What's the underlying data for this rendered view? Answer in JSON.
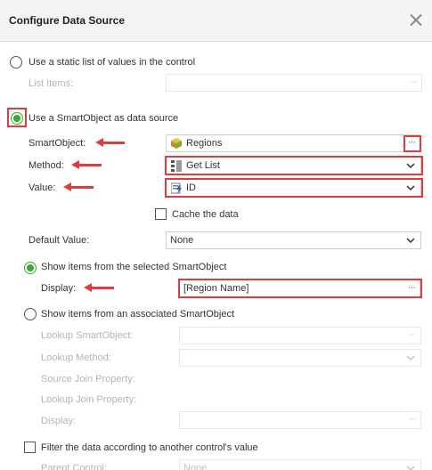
{
  "dialog": {
    "title": "Configure Data Source"
  },
  "static_list": {
    "label": "Use a static list of values in the control",
    "list_items_label": "List Items:",
    "ellipsis": "···"
  },
  "smartobject": {
    "label": "Use a SmartObject as data source",
    "smartobject_label": "SmartObject:",
    "smartobject_value": "Regions",
    "method_label": "Method:",
    "method_value": "Get List",
    "value_label": "Value:",
    "value_value": "ID",
    "cache_label": "Cache the data",
    "default_value_label": "Default Value:",
    "default_value_value": "None",
    "ellipsis": "···"
  },
  "show_selected": {
    "label": "Show items from the selected SmartObject",
    "display_label": "Display:",
    "display_value": "[Region Name]",
    "ellipsis": "···"
  },
  "show_associated": {
    "label": "Show items from an associated SmartObject",
    "lookup_smartobject_label": "Lookup SmartObject:",
    "lookup_method_label": "Lookup Method:",
    "source_join_label": "Source Join Property:",
    "lookup_join_label": "Lookup Join Property:",
    "display_label": "Display:",
    "ellipsis": "···"
  },
  "filter": {
    "label": "Filter the data according to another control's value",
    "parent_control_label": "Parent Control:",
    "parent_control_value": "None"
  },
  "colors": {
    "accent_green": "#3aaa35",
    "highlight_red": "#e23b3b"
  }
}
